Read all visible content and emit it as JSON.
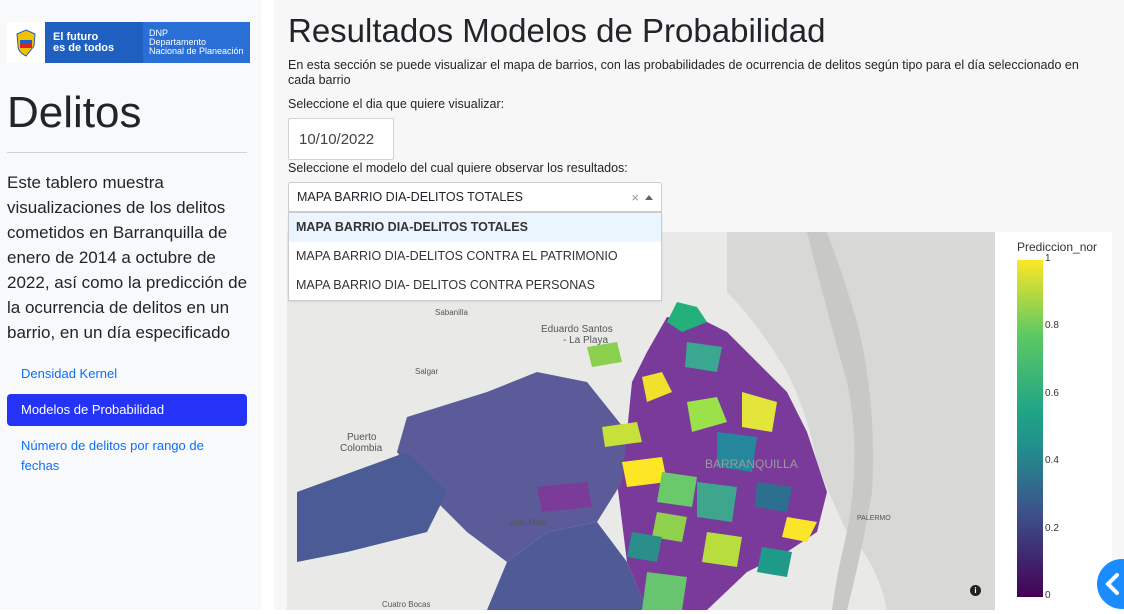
{
  "sidebar": {
    "logo": {
      "line1": "El futuro",
      "line2": "es de todos",
      "dnp": "DNP",
      "dept1": "Departamento",
      "dept2": "Nacional de Planeación"
    },
    "title": "Delitos",
    "description": "Este tablero muestra visualizaciones de los delitos cometidos en Barranquilla de enero de 2014 a octubre de 2022, así como la predicción de la ocurrencia de delitos en un barrio, en un día especificado",
    "nav": [
      {
        "label": "Densidad Kernel",
        "active": false
      },
      {
        "label": "Modelos de Probabilidad",
        "active": true
      },
      {
        "label": "Número de delitos por rango de fechas",
        "active": false
      }
    ]
  },
  "main": {
    "title": "Resultados Modelos de Probabilidad",
    "intro": "En esta sección se puede visualizar el mapa de barrios, con las probabilidades de ocurrencia de delitos según tipo para el día seleccionado en cada barrio",
    "date_label": "Seleccione el dia que quiere visualizar:",
    "date_value": "10/10/2022",
    "model_label": "Seleccione el modelo del cual quiere observar los resultados:",
    "model_value": "MAPA BARRIO DIA-DELITOS TOTALES",
    "clear_symbol": "×",
    "options": [
      "MAPA BARRIO DIA-DELITOS TOTALES",
      "MAPA BARRIO DIA-DELITOS CONTRA EL PATRIMONIO",
      "MAPA BARRIO DIA- DELITOS CONTRA PERSONAS"
    ]
  },
  "map": {
    "places": [
      "Sabanilla",
      "Eduardo Santos",
      "- La Playa",
      "Salgar",
      "Puerto",
      "Colombia",
      "BARRANQUILLA",
      "PALERMO",
      "Juan Mina",
      "Cuatro Bocas"
    ],
    "info_icon": "info-icon"
  },
  "legend": {
    "title": "Prediccion_nor",
    "ticks": [
      "1",
      "0.8",
      "0.6",
      "0.4",
      "0.2",
      "0"
    ],
    "colors": [
      "#fde725",
      "#20c05a",
      "#1fa187",
      "#277f8e",
      "#3b528b",
      "#46327e",
      "#440154"
    ]
  }
}
